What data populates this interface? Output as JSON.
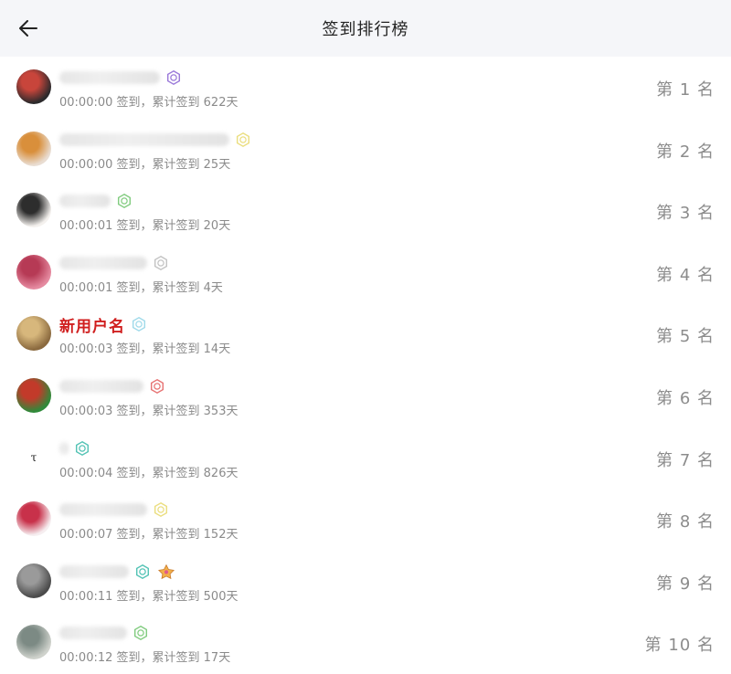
{
  "header": {
    "title": "签到排行榜"
  },
  "rows": [
    {
      "time": "00:00:00 签到，累计签到 622天",
      "rank": "第 1 名",
      "badge_color": "#8a63d2",
      "name_blur_width": 110
    },
    {
      "time": "00:00:00 签到，累计签到 25天",
      "rank": "第 2 名",
      "badge_color": "#e8d86a",
      "name_blur_width": 186
    },
    {
      "time": "00:00:01 签到，累计签到 20天",
      "rank": "第 3 名",
      "badge_color": "#6cc36a",
      "name_blur_width": 56
    },
    {
      "time": "00:00:01 签到，累计签到 4天",
      "rank": "第 4 名",
      "badge_color": "#b9b9b9",
      "name_blur_width": 96
    },
    {
      "name": "新用户名",
      "time": "00:00:03 签到，累计签到 14天",
      "rank": "第 5 名",
      "badge_color": "#8fd3e6"
    },
    {
      "time": "00:00:03 签到，累计签到 353天",
      "rank": "第 6 名",
      "badge_color": "#e35b5b",
      "name_blur_width": 92
    },
    {
      "time": "00:00:04 签到，累计签到 826天",
      "rank": "第 7 名",
      "badge_color": "#36b8a8",
      "name_blur_width": 10,
      "avatar_letter": "τ"
    },
    {
      "time": "00:00:07 签到，累计签到 152天",
      "rank": "第 8 名",
      "badge_color": "#e8d86a",
      "name_blur_width": 96
    },
    {
      "time": "00:00:11 签到，累计签到 500天",
      "rank": "第 9 名",
      "badge_color": "#36b8a8",
      "name_blur_width": 76,
      "has_medal": true
    },
    {
      "time": "00:00:12 签到，累计签到 17天",
      "rank": "第 10 名",
      "badge_color": "#6cc36a",
      "name_blur_width": 74
    }
  ],
  "avatars": [
    [
      "#2c2a2c",
      "#c8453b"
    ],
    [
      "#e9ddd2",
      "#d98f3b"
    ],
    [
      "#f4f1ee",
      "#2d2d2d"
    ],
    [
      "#e58aa0",
      "#b63a55"
    ],
    [
      "#8b6a3f",
      "#d7b77c"
    ],
    [
      "#2f8a3a",
      "#c23a2a"
    ],
    [
      "#ffffff",
      "#ffffff"
    ],
    [
      "#f6eef0",
      "#c8314a"
    ],
    [
      "#4b4b4b",
      "#9a9a9a"
    ],
    [
      "#cfd2cc",
      "#7c8a84"
    ]
  ]
}
